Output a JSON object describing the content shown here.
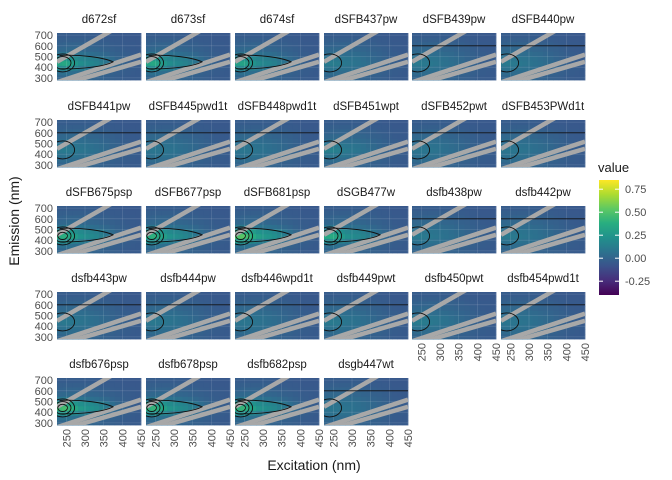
{
  "chart_data": {
    "type": "heatmap",
    "title": "",
    "xlabel": "Excitation (nm)",
    "ylabel": "Emission (nm)",
    "xlim": [
      225,
      450
    ],
    "ylim": [
      280,
      720
    ],
    "x_ticks": [
      250,
      300,
      350,
      400,
      450
    ],
    "y_ticks": [
      300,
      400,
      500,
      600,
      700
    ],
    "colorscale": "viridis",
    "grid": true,
    "legend": {
      "title": "value",
      "position": "right",
      "min": -0.4,
      "max": 0.85,
      "breaks": [
        0.75,
        0.5,
        0.25,
        0.0,
        -0.25
      ],
      "break_labels": [
        "0.75",
        "0.50",
        "0.25",
        "0.00",
        "-0.25"
      ]
    },
    "panels": [
      {
        "name": "d672sf",
        "peak": 0.28
      },
      {
        "name": "d673sf",
        "peak": 0.28
      },
      {
        "name": "d674sf",
        "peak": 0.25
      },
      {
        "name": "dSFB437pw",
        "peak": 0.06
      },
      {
        "name": "dSFB439pw",
        "peak": 0.05
      },
      {
        "name": "dSFB440pw",
        "peak": 0.05
      },
      {
        "name": "dSFB441pw",
        "peak": 0.05
      },
      {
        "name": "dSFB445pwd1t",
        "peak": 0.03
      },
      {
        "name": "dSFB448pwd1t",
        "peak": 0.03
      },
      {
        "name": "dSFB451wpt",
        "peak": 0.08
      },
      {
        "name": "dSFB452pwt",
        "peak": 0.03
      },
      {
        "name": "dSFB453PWd1t",
        "peak": 0.03
      },
      {
        "name": "dSFB675psp",
        "peak": 0.32
      },
      {
        "name": "dSFB677psp",
        "peak": 0.33
      },
      {
        "name": "dSFB681psp",
        "peak": 0.45
      },
      {
        "name": "dSGB477w",
        "peak": 0.3
      },
      {
        "name": "dsfb438pw",
        "peak": 0.05
      },
      {
        "name": "dsfb442pw",
        "peak": 0.05
      },
      {
        "name": "dsfb443pw",
        "peak": 0.04
      },
      {
        "name": "dsfb444pw",
        "peak": 0.04
      },
      {
        "name": "dsfb446wpd1t",
        "peak": 0.03
      },
      {
        "name": "dsfb449pwt",
        "peak": 0.05
      },
      {
        "name": "dsfb450pwt",
        "peak": 0.06
      },
      {
        "name": "dsfb454pwd1t",
        "peak": 0.03
      },
      {
        "name": "dsfb676psp",
        "peak": 0.4
      },
      {
        "name": "dsfb678psp",
        "peak": 0.35
      },
      {
        "name": "dsfb682psp",
        "peak": 0.35
      },
      {
        "name": "dsgb447wt",
        "peak": 0.03
      }
    ]
  }
}
